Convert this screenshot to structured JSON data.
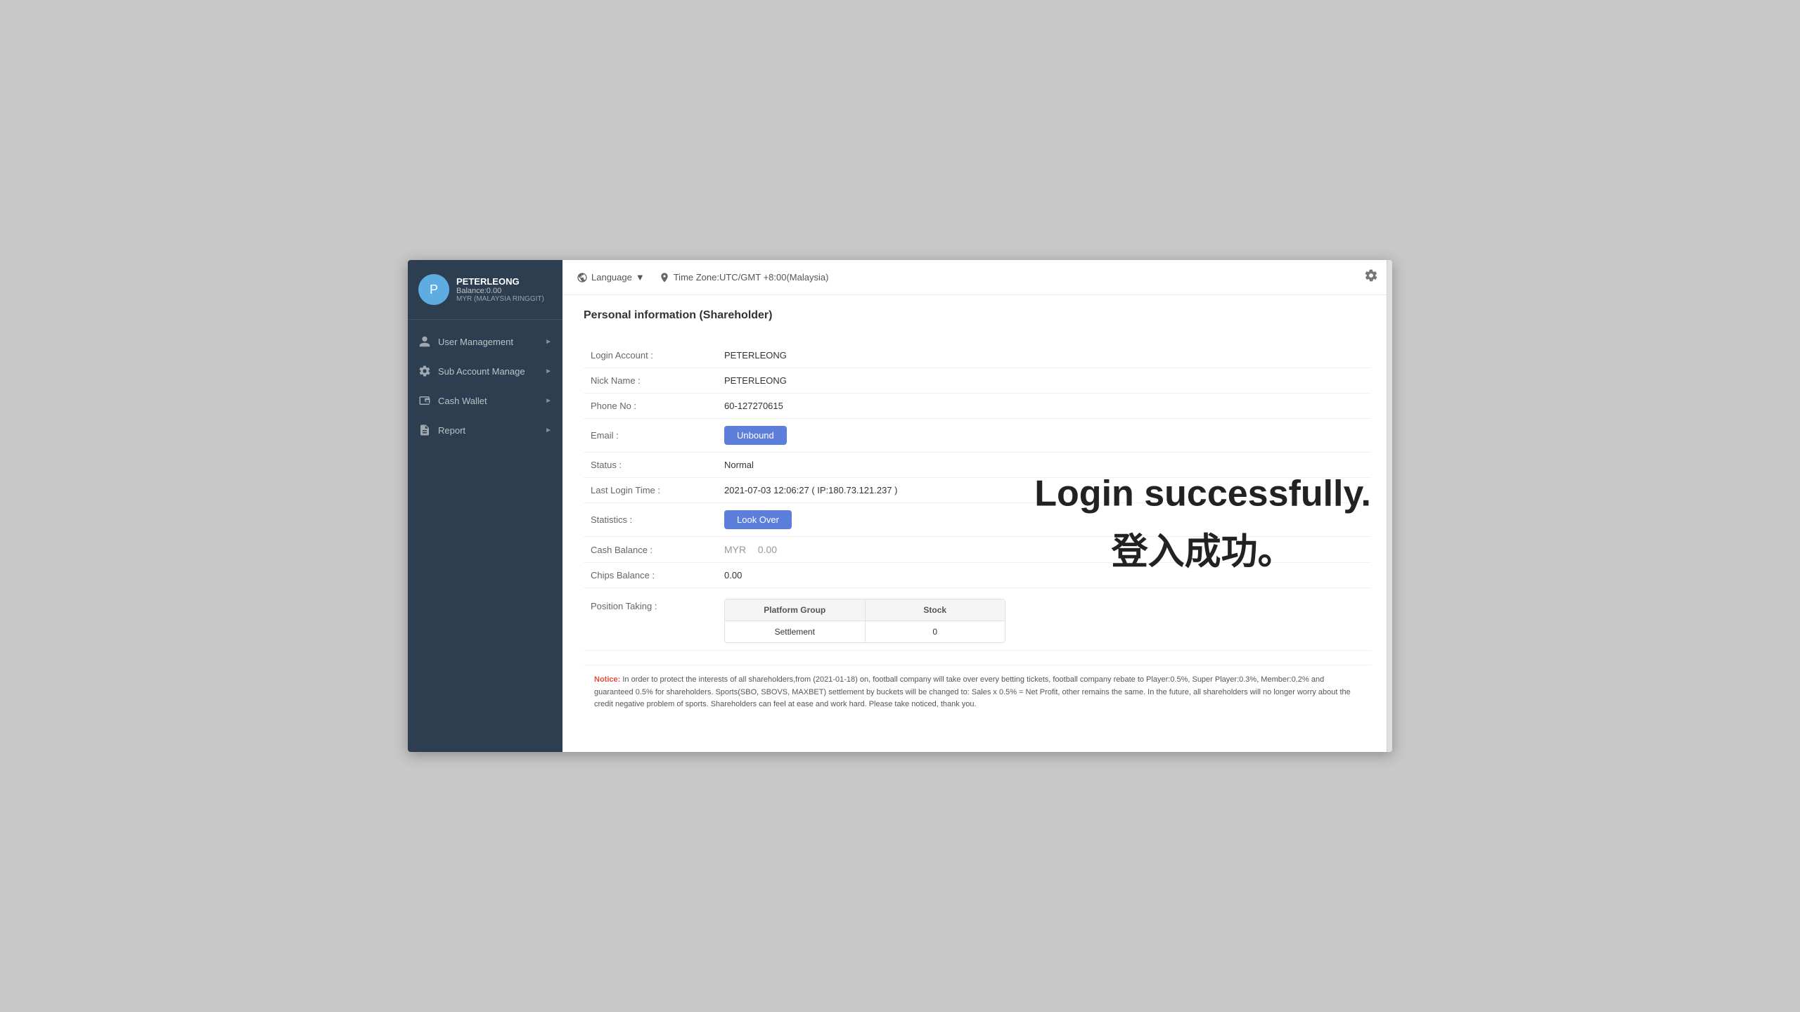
{
  "sidebar": {
    "profile": {
      "name": "PETERLEONG",
      "balance_label": "Balance:0.00",
      "currency": "MYR (MALAYSIA RINGGIT)",
      "avatar_letter": "P"
    },
    "nav_items": [
      {
        "id": "user-management",
        "label": "User Management",
        "icon": "person"
      },
      {
        "id": "sub-account-manage",
        "label": "Sub Account Manage",
        "icon": "settings"
      },
      {
        "id": "cash-wallet",
        "label": "Cash Wallet",
        "icon": "wallet"
      },
      {
        "id": "report",
        "label": "Report",
        "icon": "document"
      }
    ]
  },
  "header": {
    "language_label": "Language",
    "timezone_label": "Time Zone:UTC/GMT +8:00(Malaysia)"
  },
  "page": {
    "title": "Personal information (Shareholder)",
    "fields": [
      {
        "label": "Login Account :",
        "value": "PETERLEONG",
        "type": "text"
      },
      {
        "label": "Nick Name :",
        "value": "PETERLEONG",
        "type": "text"
      },
      {
        "label": "Phone No :",
        "value": "60-127270615",
        "type": "text"
      },
      {
        "label": "Email :",
        "value": "",
        "type": "button_unbound"
      },
      {
        "label": "Status :",
        "value": "Normal",
        "type": "text"
      },
      {
        "label": "Last Login Time :",
        "value": "2021-07-03 12:06:27 ( IP:180.73.121.237 )",
        "type": "text"
      },
      {
        "label": "Statistics :",
        "value": "",
        "type": "button_look_over"
      },
      {
        "label": "Cash Balance :",
        "value": "MYR  0.00",
        "value_currency": "MYR",
        "value_amount": "0.00",
        "type": "cash"
      },
      {
        "label": "Chips Balance :",
        "value": "0.00",
        "type": "text"
      },
      {
        "label": "Position Taking :",
        "value": "",
        "type": "position_table"
      }
    ],
    "buttons": {
      "unbound": "Unbound",
      "look_over": "Look Over"
    },
    "position_table": {
      "headers": [
        "Platform Group",
        "Stock"
      ],
      "rows": [
        {
          "col1": "Settlement",
          "col2": "0"
        }
      ]
    }
  },
  "notice": {
    "label": "Notice:",
    "text": " In order to protect the interests of all shareholders,from (2021-01-18) on, football company will take over every betting tickets, football company rebate to Player:0.5%, Super Player:0.3%, Member:0.2% and guaranteed 0.5% for shareholders. Sports(SBO, SBOVS, MAXBET) settlement by buckets will be changed to: Sales x 0.5% = Net Profit, other remains the same.\nIn the future, all shareholders will no longer worry about the credit negative problem of sports. Shareholders can feel at ease and work hard. Please take noticed, thank you."
  },
  "login_success": {
    "english": "Login successfully.",
    "chinese": "登入成功。"
  }
}
